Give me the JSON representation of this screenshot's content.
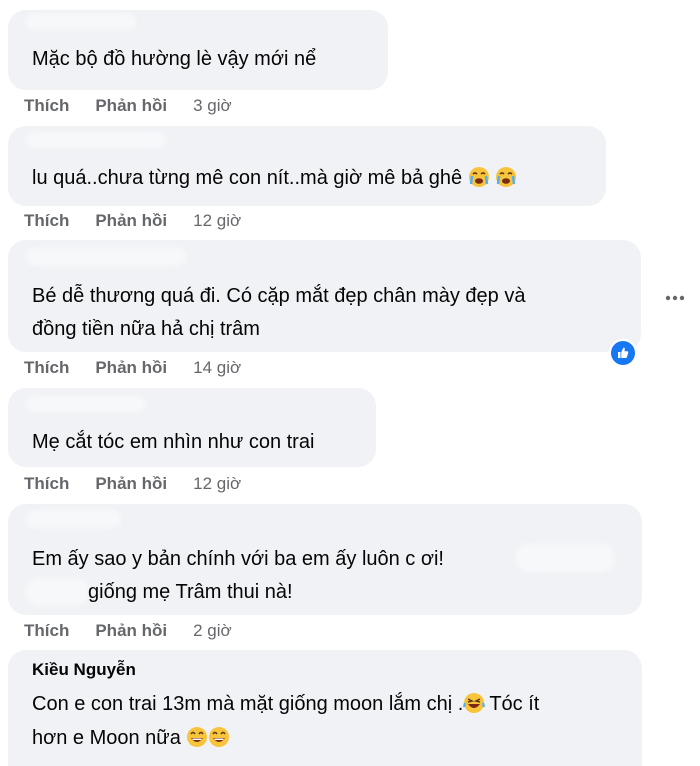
{
  "comments": [
    {
      "author": "",
      "text": "Mặc bộ đồ hường lè vậy mới nể",
      "like": "Thích",
      "reply": "Phản hồi",
      "time": "3 giờ"
    },
    {
      "author": "",
      "text": "lu quá..chưa từng mê con nít..mà giờ mê bả ghê",
      "like": "Thích",
      "reply": "Phản hồi",
      "time": "12 giờ",
      "emojis": [
        "tearful-face",
        "tearful-face"
      ]
    },
    {
      "author": "",
      "text": "Bé dễ thương quá đi. Có cặp mắt đẹp chân mày đẹp và\nđồng tiền nữa hả chị trâm",
      "like": "Thích",
      "reply": "Phản hồi",
      "time": "14 giờ",
      "reaction": "like"
    },
    {
      "author": "",
      "text": "Mẹ cắt tóc em nhìn như con trai",
      "like": "Thích",
      "reply": "Phản hồi",
      "time": "12 giờ"
    },
    {
      "author": "",
      "text": "Em ấy sao y bản chính với ba em ấy luôn c ơi!",
      "text2": "giống mẹ Trâm thui nà!",
      "like": "Thích",
      "reply": "Phản hồi",
      "time": "2 giờ"
    },
    {
      "author": "Kiều Nguyễn",
      "text": "Con e con trai 13m mà mặt giống moon lắm chị .",
      "text_b": "Tóc ít",
      "text2": "hơn e Moon nữa",
      "emojis": [
        "laughing-face",
        "grinning-face",
        "grinning-face"
      ]
    }
  ],
  "colors": {
    "bubble": "#f0f2f5",
    "text": "#050505",
    "meta": "#65676b",
    "like_blue": "#1877f2"
  }
}
